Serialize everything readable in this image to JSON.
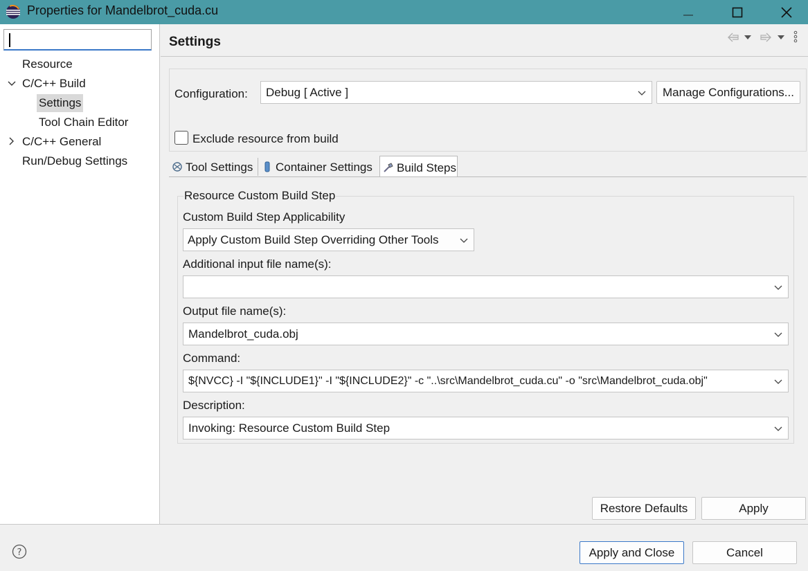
{
  "window": {
    "title": "Properties for Mandelbrot_cuda.cu",
    "controls": [
      "minimize",
      "maximize",
      "close"
    ]
  },
  "sidebar": {
    "filter_placeholder": "",
    "items": [
      {
        "label": "Resource",
        "level": 0,
        "expandable": false
      },
      {
        "label": "C/C++ Build",
        "level": 0,
        "expandable": true,
        "expanded": true
      },
      {
        "label": "Settings",
        "level": 1,
        "selected": true
      },
      {
        "label": "Tool Chain Editor",
        "level": 1
      },
      {
        "label": "C/C++ General",
        "level": 0,
        "expandable": true,
        "expanded": false
      },
      {
        "label": "Run/Debug Settings",
        "level": 0,
        "expandable": false
      }
    ]
  },
  "header": {
    "title": "Settings",
    "nav_icons": [
      "back-arrow-icon",
      "dropdown-icon",
      "forward-arrow-icon",
      "dropdown-icon",
      "more-vert-icon"
    ]
  },
  "configuration": {
    "label": "Configuration:",
    "value": "Debug  [ Active ]",
    "manage_button": "Manage Configurations...",
    "exclude_label": "Exclude resource from build",
    "exclude_checked": false
  },
  "tabs": [
    {
      "label": "Tool Settings",
      "icon": "tool-settings-icon",
      "active": false
    },
    {
      "label": "Container Settings",
      "icon": "container-icon",
      "active": false
    },
    {
      "label": "Build Steps",
      "icon": "build-steps-icon",
      "active": true
    }
  ],
  "build_step": {
    "group_title": "Resource Custom Build Step",
    "applicability_label": "Custom Build Step Applicability",
    "applicability_value": "Apply Custom Build Step Overriding Other Tools",
    "input_label": "Additional input file name(s):",
    "input_value": "",
    "output_label": "Output file name(s):",
    "output_value": "Mandelbrot_cuda.obj",
    "command_label": "Command:",
    "command_value": "${NVCC}  -I \"${INCLUDE1}\" -I \"${INCLUDE2}\"  -c \"..\\src\\Mandelbrot_cuda.cu\" -o \"src\\Mandelbrot_cuda.obj\"",
    "description_label": "Description:",
    "description_value": "Invoking: Resource Custom Build Step"
  },
  "page_buttons": {
    "restore_defaults": "Restore Defaults",
    "apply": "Apply"
  },
  "dialog_buttons": {
    "apply_and_close": "Apply and Close",
    "cancel": "Cancel"
  },
  "colors": {
    "titlebar": "#4a9ba6",
    "focus_accent": "#3a78c8",
    "background": "#f0f0f0"
  }
}
